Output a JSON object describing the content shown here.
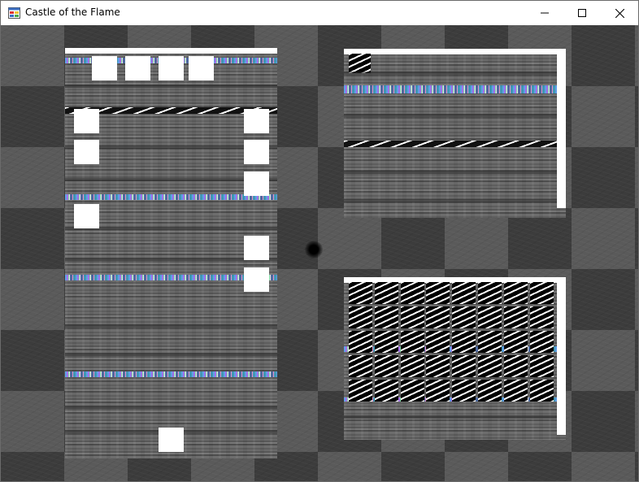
{
  "window": {
    "title": "Castle of the Flame",
    "icon": "app-window-icon",
    "controls": {
      "minimize_icon": "minimize-icon",
      "maximize_icon": "maximize-icon",
      "close_icon": "close-icon"
    }
  },
  "colors": {
    "titlebar_bg": "#ffffff",
    "board_dark": "#3c3c3c",
    "board_light": "#5a5a5a",
    "block": "#ffffff",
    "sparkle": "#5fa8ff"
  },
  "game": {
    "panels": [
      "left-tower-panel",
      "top-right-panel",
      "bottom-right-panel"
    ]
  }
}
